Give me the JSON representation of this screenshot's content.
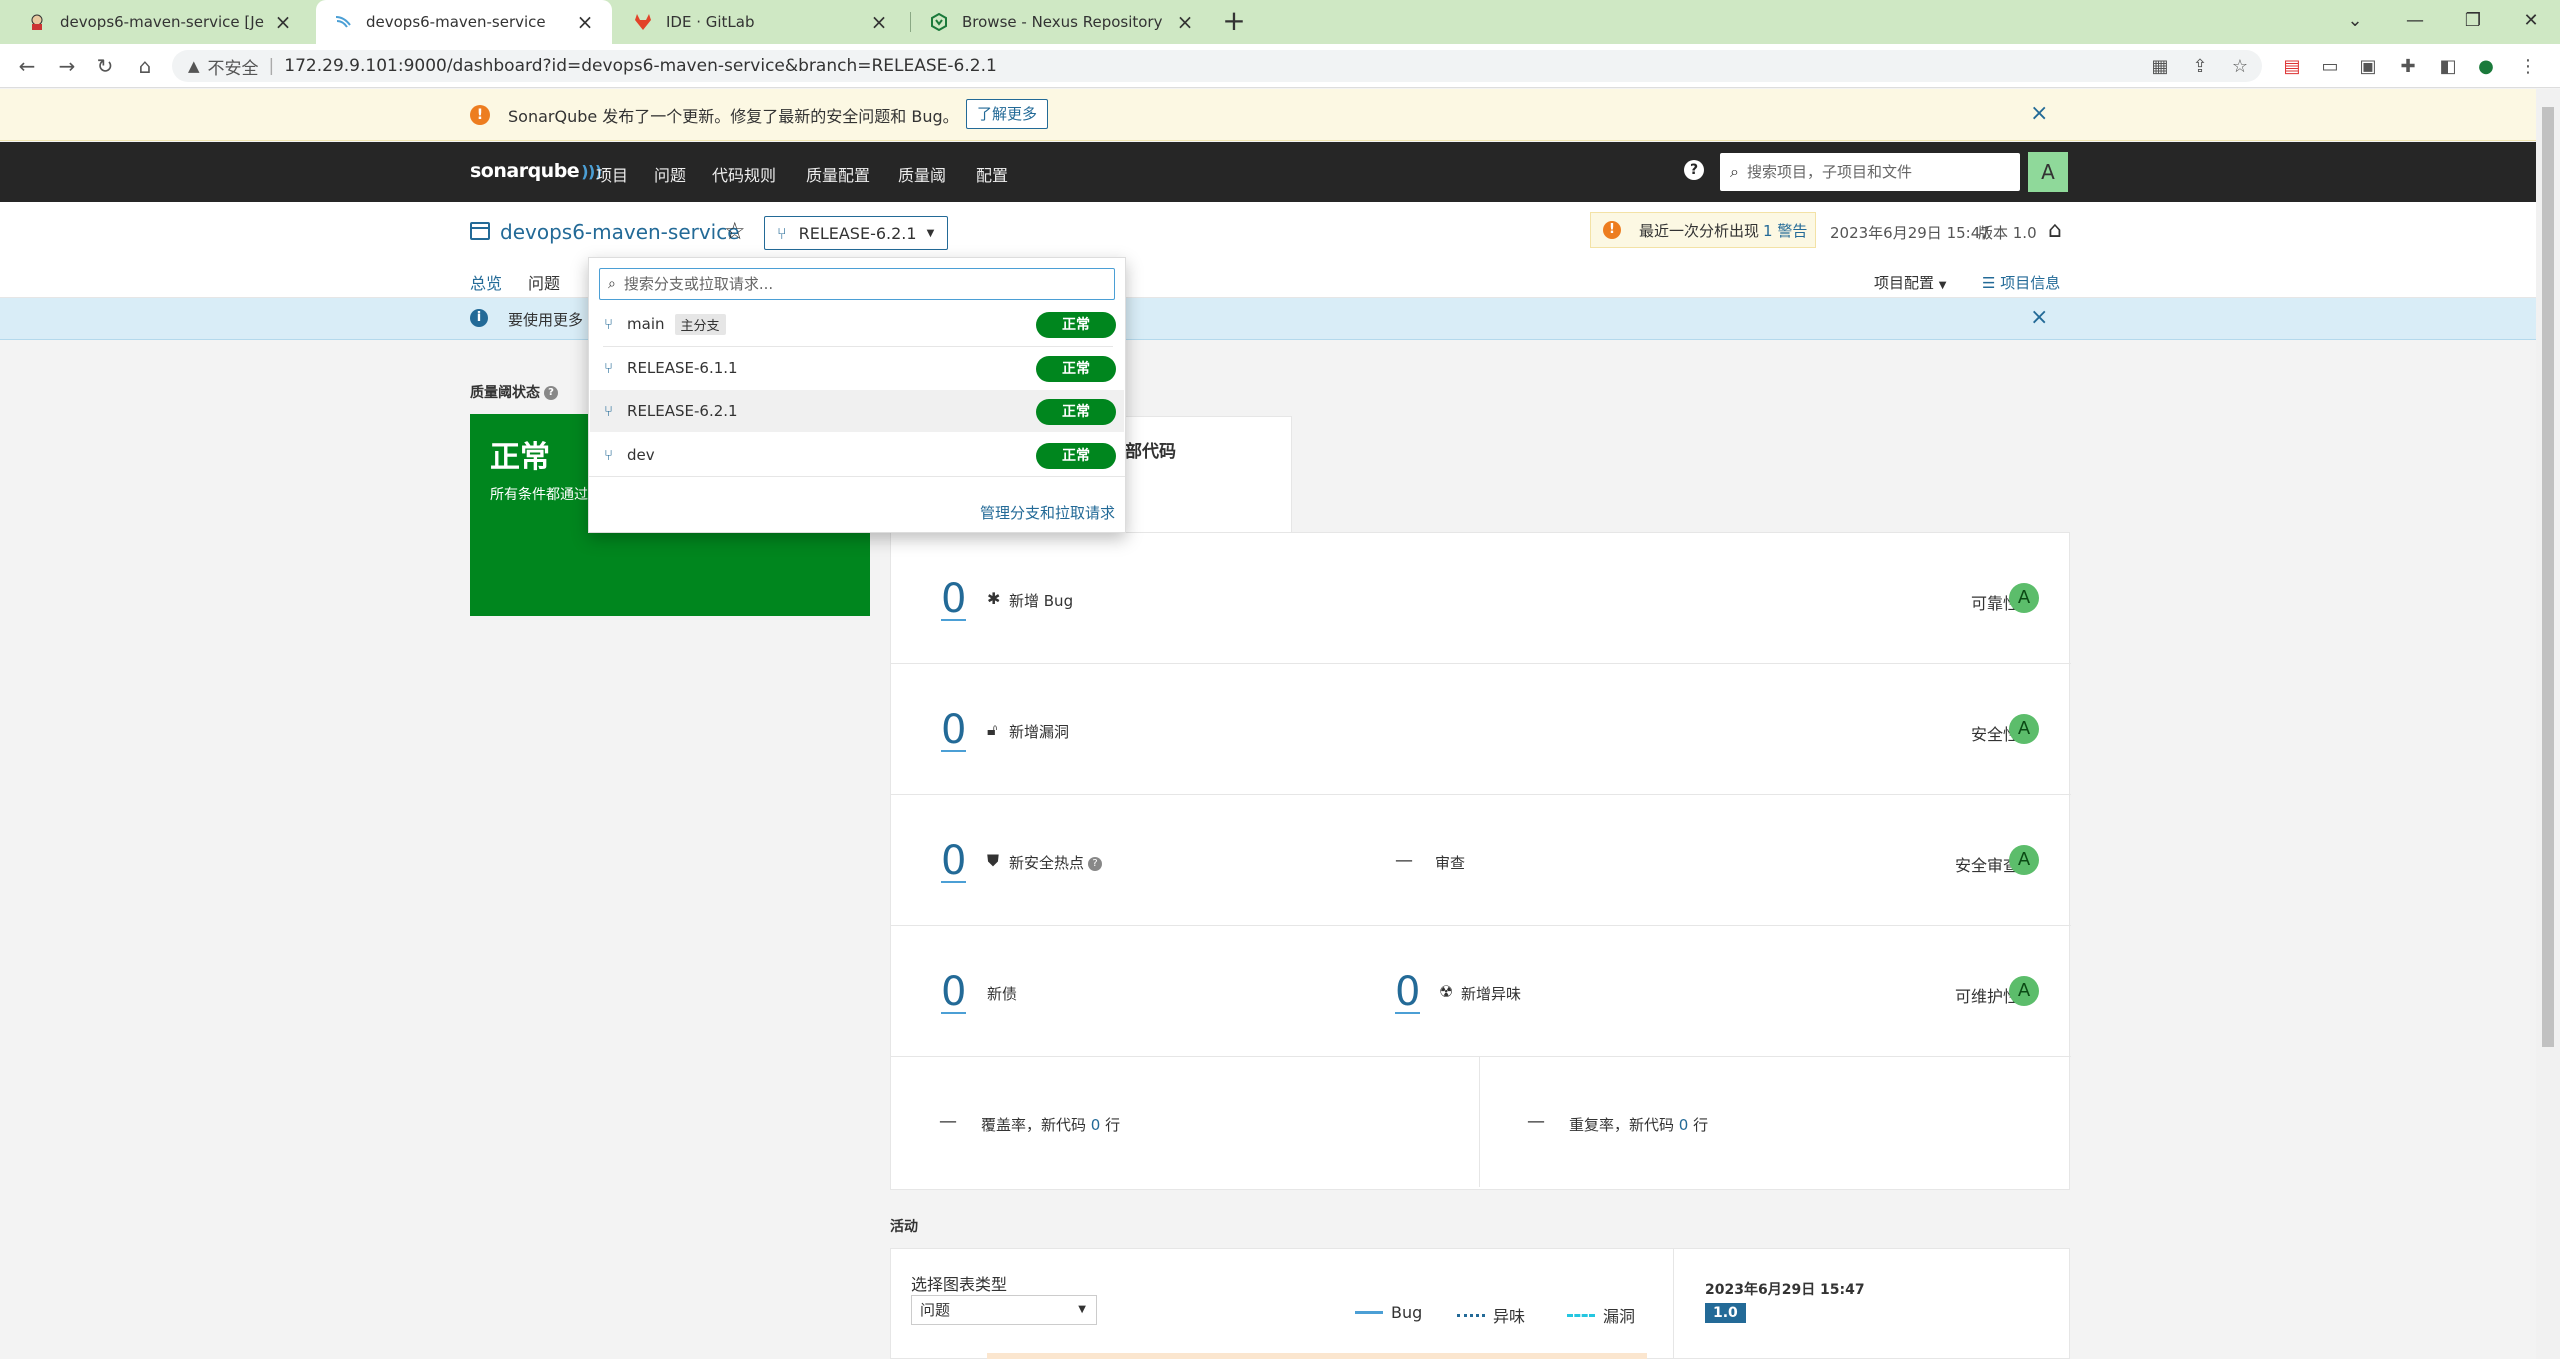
{
  "browser": {
    "tabs": [
      {
        "title": "devops6-maven-service [Jenki",
        "icon": "jenkins-icon"
      },
      {
        "title": "devops6-maven-service",
        "icon": "sonarqube-icon"
      },
      {
        "title": "IDE · GitLab",
        "icon": "gitlab-icon"
      },
      {
        "title": "Browse - Nexus Repository Ma",
        "icon": "nexus-icon"
      }
    ],
    "insecure_label": "不安全",
    "url": "172.29.9.101:9000/dashboard?id=devops6-maven-service&branch=RELEASE-6.2.1"
  },
  "update_banner": {
    "message": "SonarQube 发布了一个更新。修复了最新的安全问题和 Bug。",
    "learn_more": "了解更多"
  },
  "nav": {
    "logo": "sonarqube",
    "items": [
      "项目",
      "问题",
      "代码规则",
      "质量配置",
      "质量阈",
      "配置"
    ],
    "search_placeholder": "搜索项目，子项目和文件",
    "avatar": "A"
  },
  "project": {
    "name": "devops6-maven-service",
    "branch": "RELEASE-6.2.1",
    "warning_prefix": "最近一次分析出现",
    "warning_link": "1 警告",
    "analysis_date": "2023年6月29日 15:47",
    "version": "版本 1.0",
    "tabs": [
      "总览",
      "问题"
    ],
    "settings": "项目配置",
    "info": "项目信息"
  },
  "info_banner": {
    "text": "要使用更多"
  },
  "quality_gate": {
    "label": "质量阈状态",
    "status": "正常",
    "description": "所有条件都通过"
  },
  "code_tab": {
    "label": "部代码"
  },
  "measures": {
    "bugs": {
      "value": "0",
      "label": "新增 Bug",
      "category": "可靠性",
      "grade": "A"
    },
    "vulnerabilities": {
      "value": "0",
      "label": "新增漏洞",
      "category": "安全性",
      "grade": "A"
    },
    "hotspots": {
      "value": "0",
      "label": "新安全热点",
      "review_dash": "—",
      "review_label": "审查",
      "category": "安全审查",
      "grade": "A"
    },
    "debt": {
      "value": "0",
      "label": "新债",
      "smells_value": "0",
      "smells_label": "新增异味",
      "category": "可维护性",
      "grade": "A"
    },
    "coverage": {
      "dash": "—",
      "label_prefix": "覆盖率，新代码",
      "lines": "0",
      "label_suffix": "行"
    },
    "duplication": {
      "dash": "—",
      "label_prefix": "重复率，新代码",
      "lines": "0",
      "label_suffix": "行"
    }
  },
  "activity": {
    "label": "活动",
    "graph_type_label": "选择图表类型",
    "graph_type_value": "问题",
    "legend": [
      {
        "name": "Bug",
        "color": "#4b9fd5"
      },
      {
        "name": "异味",
        "color": "#236a97"
      },
      {
        "name": "漏洞",
        "color": "#24c6e0"
      }
    ],
    "date": "2023年6月29日 15:47",
    "version": "1.0"
  },
  "branch_dropdown": {
    "search_placeholder": "搜索分支或拉取请求...",
    "branches": [
      {
        "name": "main",
        "tag": "主分支",
        "status": "正常"
      },
      {
        "name": "RELEASE-6.1.1",
        "tag": "",
        "status": "正常"
      },
      {
        "name": "RELEASE-6.2.1",
        "tag": "",
        "status": "正常"
      },
      {
        "name": "dev",
        "tag": "",
        "status": "正常"
      }
    ],
    "manage_link": "管理分支和拉取请求"
  },
  "colors": {
    "gate_ok": "#00861e",
    "link_blue": "#236a97",
    "nav_bg": "#262626",
    "grade_a": "#5cbd6b"
  }
}
